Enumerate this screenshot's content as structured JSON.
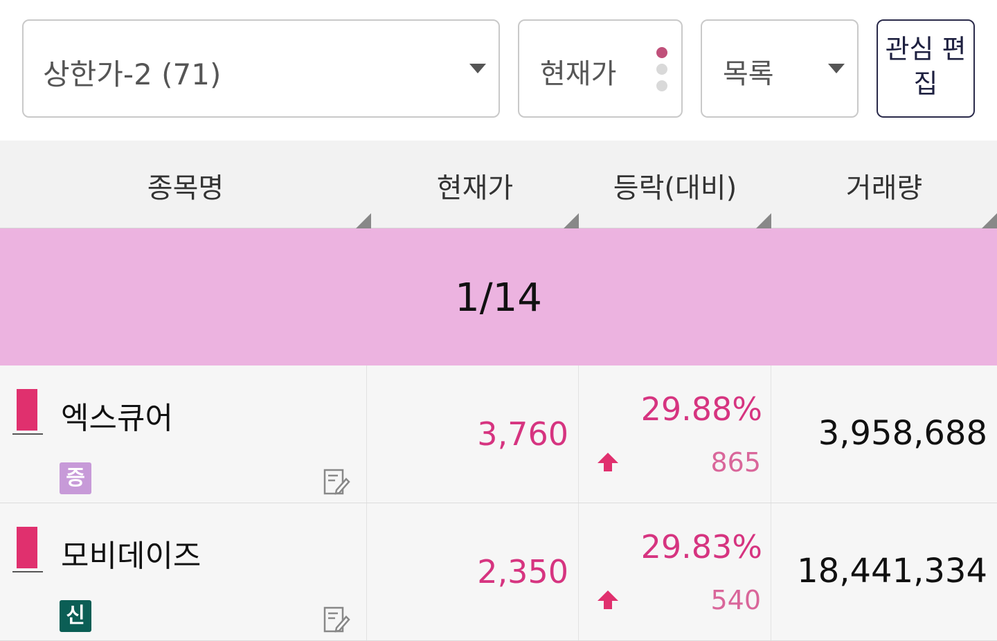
{
  "toolbar": {
    "group_select": "상한가-2 (71)",
    "price_toggle": "현재가",
    "view_select": "목록",
    "edit_button": "관심 편집"
  },
  "table": {
    "headers": [
      "종목명",
      "현재가",
      "등락(대비)",
      "거래량"
    ],
    "page_indicator": "1/14",
    "rows": [
      {
        "name": "엑스큐어",
        "badge": "증",
        "badge_color": "#c79ad8",
        "marker_color": "#e0306e",
        "price": "3,760",
        "change_rate": "29.88%",
        "change_amount": "865",
        "direction_icon": "up-arrow-icon",
        "volume": "3,958,688"
      },
      {
        "name": "모비데이즈",
        "badge": "신",
        "badge_color": "#0b5e55",
        "marker_color": "#e0306e",
        "price": "2,350",
        "change_rate": "29.83%",
        "change_amount": "540",
        "direction_icon": "up-arrow-icon",
        "volume": "18,441,334"
      }
    ]
  },
  "colors": {
    "rise": "#d63480",
    "banner": "#ecb3e0",
    "active_dot": "#c0507a"
  }
}
